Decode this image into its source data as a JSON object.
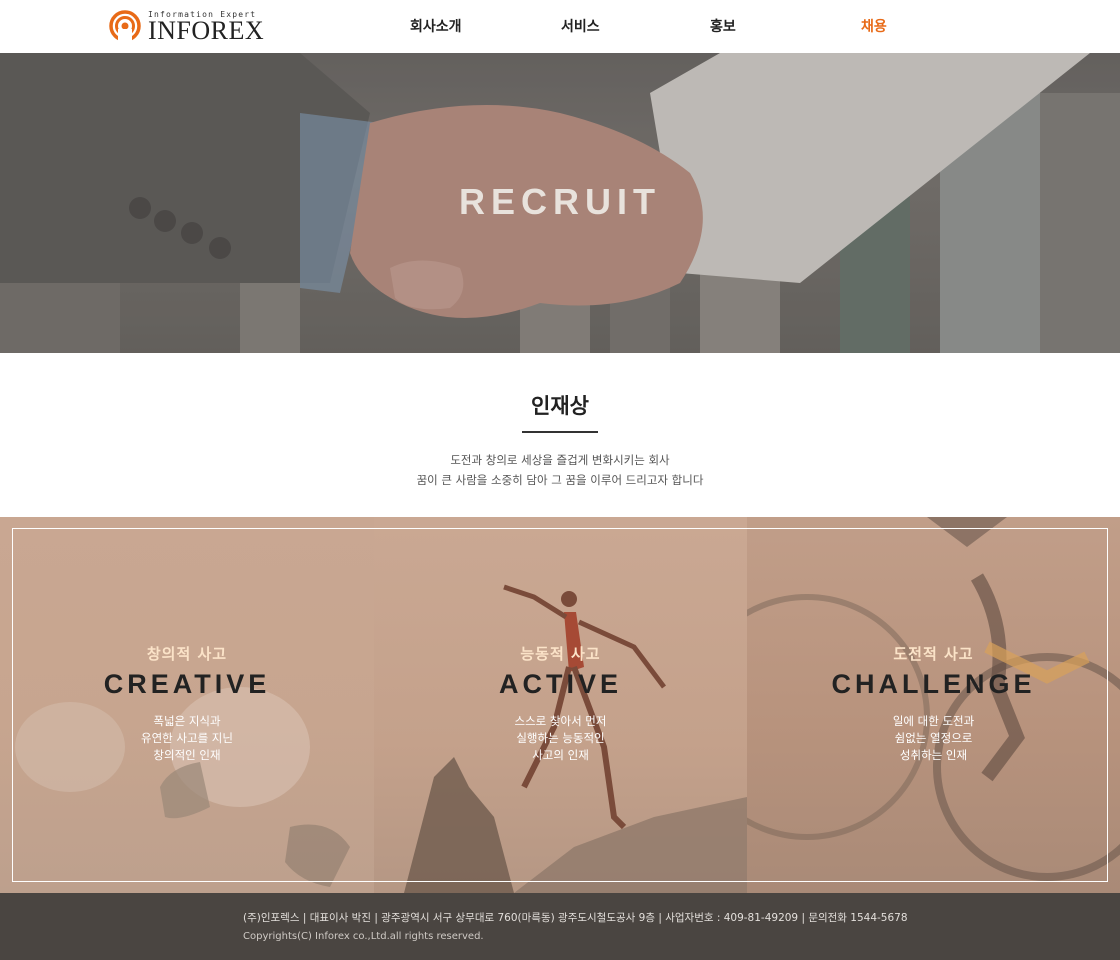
{
  "brand": {
    "tagline": "Information Expert",
    "name": "INFOREX",
    "accent_color": "#e86a17"
  },
  "nav": [
    {
      "label": "회사소개"
    },
    {
      "label": "서비스"
    },
    {
      "label": "홍보"
    },
    {
      "label": "채용",
      "active": true
    }
  ],
  "hero": {
    "title": "RECRUIT"
  },
  "intro": {
    "title": "인재상",
    "lines": [
      "도전과 창의로 세상을 즐겁게 변화시키는 회사",
      "꿈이 큰 사람을 소중히 담아 그 꿈을 이루어 드리고자 합니다"
    ]
  },
  "values": [
    {
      "ko": "창의적 사고",
      "en": "CREATIVE",
      "desc": [
        "폭넓은 지식과",
        "유연한 사고를 지닌",
        "창의적인 인재"
      ]
    },
    {
      "ko": "능동적 사고",
      "en": "ACTIVE",
      "desc": [
        "스스로 찾아서 먼저",
        "실행하는 능동적인",
        "사고의 인재"
      ]
    },
    {
      "ko": "도전적 사고",
      "en": "CHALLENGE",
      "desc": [
        "일에 대한 도전과",
        "쉼없는 열정으로",
        "성취하는 인재"
      ]
    }
  ],
  "footer": {
    "info": "(주)인포렉스  |  대표이사 박진  |  광주광역시 서구 상무대로 760(마륵동) 광주도시철도공사 9층  |  사업자번호 : 409-81-49209  |  문의전화 1544-5678",
    "copyright": "Copyrights(C) Inforex co.,Ltd.all rights reserved."
  }
}
